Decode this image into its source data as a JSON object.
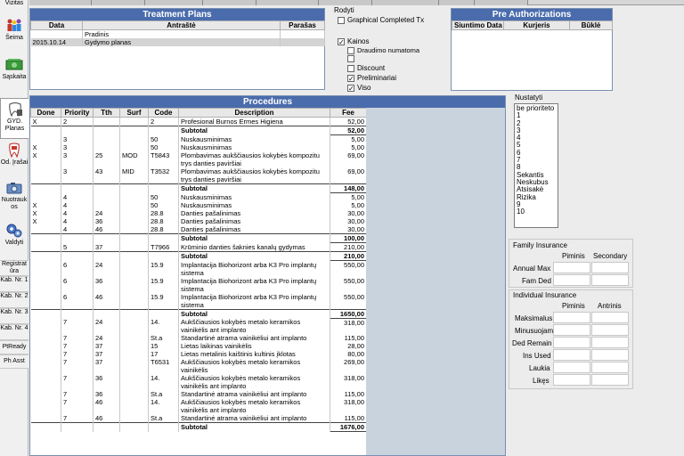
{
  "nav": {
    "vizitas": "Vizitas",
    "seima": "Šeima",
    "saskaita": "Sąskaita",
    "gyd_planas": "GYD. Planas",
    "od_irasai": "Od. Įrašai",
    "nuotraukos": "Nuotrauk os",
    "valdyti": "Valdyti",
    "registratura": "Registrat ūra",
    "kab1": "Kab. Nr. 1",
    "kab2": "Kab. Nr. 2",
    "kab3": "Kab. Nr. 3",
    "kab4": "Kab. Nr. 4",
    "ptready": "PtReady",
    "phasst": "Ph Asst"
  },
  "treatment_plans": {
    "title": "Treatment Plans",
    "columns": [
      "Data",
      "Antraštė",
      "Parašas"
    ],
    "rows": [
      {
        "data": "",
        "antraste": "Pradinis",
        "parasas": "",
        "selected": false
      },
      {
        "data": "2015.10.14",
        "antraste": "Gydymo planas",
        "parasas": "",
        "selected": true
      }
    ]
  },
  "rodyti": {
    "label": "Rodyti",
    "graphical": "Graphical Completed Tx",
    "graphical_checked": false,
    "kainos": "Kainos",
    "kainos_checked": true,
    "options": [
      {
        "label": "Draudimo numatoma",
        "checked": false
      },
      {
        "label": "",
        "checked": false
      },
      {
        "label": "Discount",
        "checked": false
      },
      {
        "label": "Preliminariai",
        "checked": true
      },
      {
        "label": "Viso",
        "checked": true
      }
    ]
  },
  "pre_auth": {
    "title": "Pre Authorizations",
    "columns": [
      "Siuntimo Data",
      "Kurjeris",
      "Būklė"
    ]
  },
  "procedures": {
    "title": "Procedures",
    "columns": [
      "Done",
      "Priority",
      "Tth",
      "Surf",
      "Code",
      "Description",
      "Fee"
    ],
    "rows": [
      {
        "done": "X",
        "priority": "2",
        "tth": "",
        "surf": "",
        "code": "2",
        "desc": "Profesional Burnos Ermes Higiena",
        "fee": "52,00"
      },
      {
        "sub": true,
        "desc": "Subtotal",
        "fee": "52,00"
      },
      {
        "done": "",
        "priority": "3",
        "tth": "",
        "surf": "",
        "code": "50",
        "desc": "Nuskausminimas",
        "fee": "5,00"
      },
      {
        "done": "X",
        "priority": "3",
        "tth": "",
        "surf": "",
        "code": "50",
        "desc": "Nuskausminimas",
        "fee": "5,00"
      },
      {
        "done": "X",
        "priority": "3",
        "tth": "25",
        "surf": "MOD",
        "code": "T5843",
        "desc": "Plombavimas aukščiausios kokybės kompozitu trys danties paviršiai",
        "fee": "69,00"
      },
      {
        "done": "",
        "priority": "3",
        "tth": "43",
        "surf": "MID",
        "code": "T3532",
        "desc": "Plombavimas aukščiausios kokybės kompozitu trys danties paviršiai",
        "fee": "69,00"
      },
      {
        "sub": true,
        "desc": "Subtotal",
        "fee": "148,00"
      },
      {
        "done": "",
        "priority": "4",
        "tth": "",
        "surf": "",
        "code": "50",
        "desc": "Nuskausminimas",
        "fee": "5,00"
      },
      {
        "done": "X",
        "priority": "4",
        "tth": "",
        "surf": "",
        "code": "50",
        "desc": "Nuskausminimas",
        "fee": "5,00"
      },
      {
        "done": "X",
        "priority": "4",
        "tth": "24",
        "surf": "",
        "code": "28.8",
        "desc": "Danties pašalinimas",
        "fee": "30,00"
      },
      {
        "done": "X",
        "priority": "4",
        "tth": "36",
        "surf": "",
        "code": "28.8",
        "desc": "Danties pašalinimas",
        "fee": "30,00"
      },
      {
        "done": "",
        "priority": "4",
        "tth": "46",
        "surf": "",
        "code": "28.8",
        "desc": "Danties pašalinimas",
        "fee": "30,00"
      },
      {
        "sub": true,
        "desc": "Subtotal",
        "fee": "100,00"
      },
      {
        "done": "",
        "priority": "5",
        "tth": "37",
        "surf": "",
        "code": "T7966",
        "desc": "Krūminio danties šaknies kanalų gydymas",
        "fee": "210,00"
      },
      {
        "sub": true,
        "desc": "Subtotal",
        "fee": "210,00"
      },
      {
        "done": "",
        "priority": "6",
        "tth": "24",
        "surf": "",
        "code": "15.9",
        "desc": "Implantacija Biohorizont arba K3 Pro implantų sistema",
        "fee": "550,00"
      },
      {
        "done": "",
        "priority": "6",
        "tth": "36",
        "surf": "",
        "code": "15.9",
        "desc": "Implantacija Biohorizont arba K3 Pro implantų sistema",
        "fee": "550,00"
      },
      {
        "done": "",
        "priority": "6",
        "tth": "46",
        "surf": "",
        "code": "15.9",
        "desc": "Implantacija Biohorizont arba K3 Pro implantų sistema",
        "fee": "550,00"
      },
      {
        "sub": true,
        "desc": "Subtotal",
        "fee": "1650,00"
      },
      {
        "done": "",
        "priority": "7",
        "tth": "24",
        "surf": "",
        "code": "14.",
        "desc": "Aukščiausios kokybės metalo keramikos vainikėlis ant implanto",
        "fee": "318,00"
      },
      {
        "done": "",
        "priority": "7",
        "tth": "24",
        "surf": "",
        "code": "St.a",
        "desc": "Standartinė atrama vainikėliui ant implanto",
        "fee": "115,00"
      },
      {
        "done": "",
        "priority": "7",
        "tth": "37",
        "surf": "",
        "code": "15",
        "desc": "Lietas laikinas vainikėlis",
        "fee": "28,00"
      },
      {
        "done": "",
        "priority": "7",
        "tth": "37",
        "surf": "",
        "code": "17",
        "desc": "Lietas metalinis kaištinis kultinis įklotas",
        "fee": "80,00"
      },
      {
        "done": "",
        "priority": "7",
        "tth": "37",
        "surf": "",
        "code": "T6531",
        "desc": "Aukščiausios kokybės metalo keramikos vainikėlis",
        "fee": "269,00"
      },
      {
        "done": "",
        "priority": "7",
        "tth": "36",
        "surf": "",
        "code": "14.",
        "desc": "Aukščiausios kokybės metalo keramikos vainikėlis ant implanto",
        "fee": "318,00"
      },
      {
        "done": "",
        "priority": "7",
        "tth": "36",
        "surf": "",
        "code": "St.a",
        "desc": "Standartinė atrama vainikėliui ant implanto",
        "fee": "115,00"
      },
      {
        "done": "",
        "priority": "7",
        "tth": "46",
        "surf": "",
        "code": "14.",
        "desc": "Aukščiausios kokybės metalo keramikos vainikėlis ant implanto",
        "fee": "318,00"
      },
      {
        "done": "",
        "priority": "7",
        "tth": "46",
        "surf": "",
        "code": "St.a",
        "desc": "Standartinė atrama vainikėliui ant implanto",
        "fee": "115,00"
      },
      {
        "sub": true,
        "desc": "Subtotal",
        "fee": "1676,00"
      }
    ]
  },
  "nustatyti": {
    "label": "Nustatyti",
    "items": [
      "be prioriteto",
      "1",
      "2",
      "3",
      "4",
      "5",
      "6",
      "7",
      "8",
      "Sekantis",
      "Neskubus",
      "Atsisakė",
      "Rizika",
      "9",
      "10"
    ]
  },
  "family_insurance": {
    "label": "Family Insurance",
    "col1": "Piminis",
    "col2": "Secondary",
    "rows": [
      "Annual Max",
      "Fam Ded"
    ]
  },
  "individual_insurance": {
    "label": "Individual Insurance",
    "col1": "Piminis",
    "col2": "Antrinis",
    "rows": [
      "Maksimalus",
      "Minusuojam",
      "Ded Remain",
      "Ins Used",
      "Laukia",
      "Likęs"
    ]
  }
}
